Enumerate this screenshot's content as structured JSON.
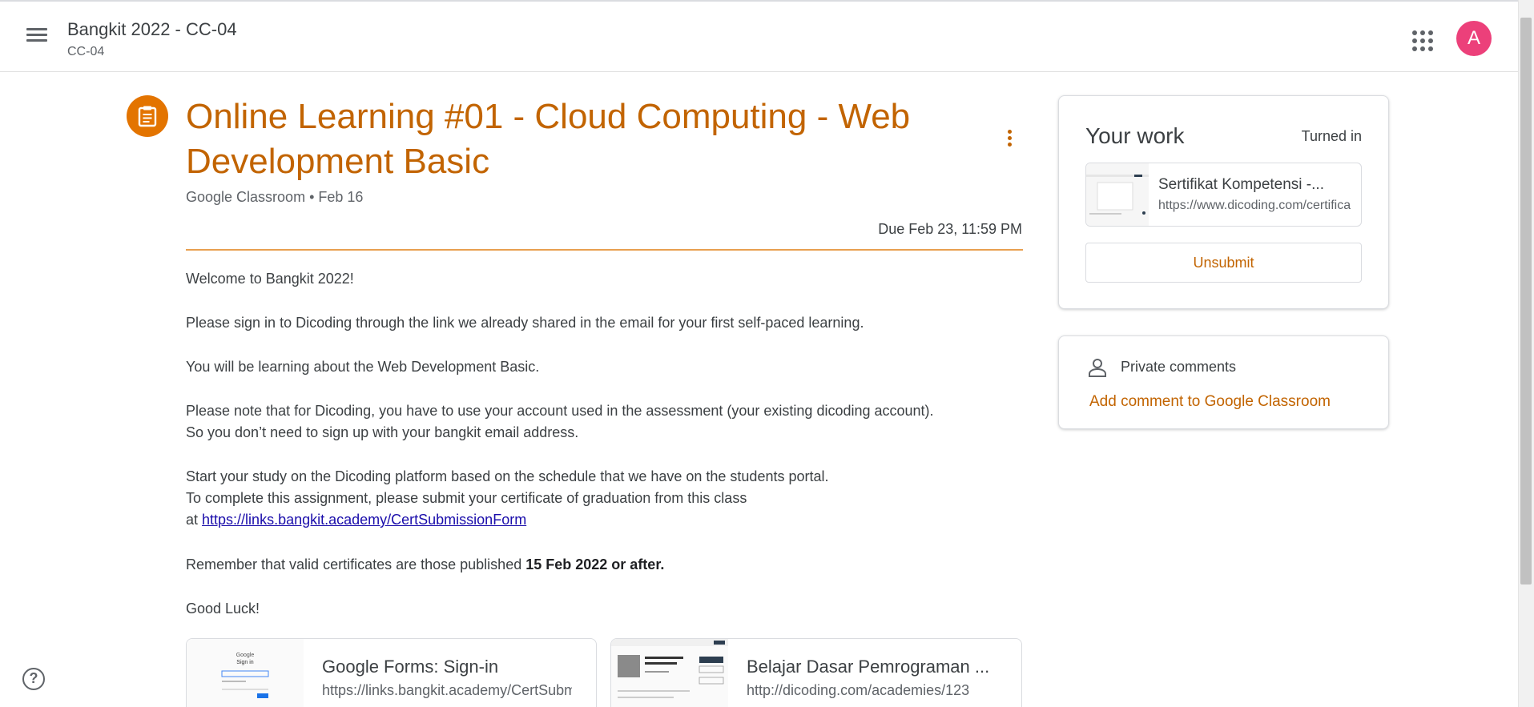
{
  "header": {
    "class_name": "Bangkit 2022 - CC-04",
    "class_section": "CC-04",
    "avatar_letter": "A",
    "avatar_color": "#ec407a"
  },
  "assignment": {
    "title": "Online Learning #01 - Cloud Computing - Web Development Basic",
    "meta": "Google Classroom • Feb 16",
    "due": "Due Feb 23, 11:59 PM",
    "accent_color": "#c26401",
    "body": {
      "p1": "Welcome to Bangkit 2022!",
      "p2": "Please sign in to Dicoding through the link we already shared in the email for your first self-paced learning.",
      "p3": "You will be learning about the Web Development Basic.",
      "p4_line1": "Please note that for Dicoding, you have to use your account used in the assessment (your existing dicoding account).",
      "p4_line2": "So you don’t need to sign up with your bangkit email address.",
      "p5_line1": "Start your study on the Dicoding platform based on the schedule that we have on the students portal.",
      "p5_line2": "To complete this assignment, please submit your certificate of graduation from this class",
      "p5_prefix": "at",
      "p5_link": "https://links.bangkit.academy/CertSubmissionForm",
      "p6_prefix": "Remember that valid certificates are those published",
      "p6_bold": "15 Feb 2022 or after.",
      "p7": "Good Luck!"
    },
    "attachments": [
      {
        "title": "Google Forms: Sign-in",
        "url": "https://links.bangkit.academy/CertSubmissionForm"
      },
      {
        "title": "Belajar Dasar Pemrograman ...",
        "url": "http://dicoding.com/academies/123"
      }
    ]
  },
  "your_work": {
    "title": "Your work",
    "status": "Turned in",
    "file_title": "Sertifikat Kompetensi -...",
    "file_url": "https://www.dicoding.com/certificates",
    "unsubmit_label": "Unsubmit"
  },
  "private_comments": {
    "title": "Private comments",
    "add_label": "Add comment to Google Classroom"
  },
  "help": {
    "icon_glyph": "?"
  }
}
